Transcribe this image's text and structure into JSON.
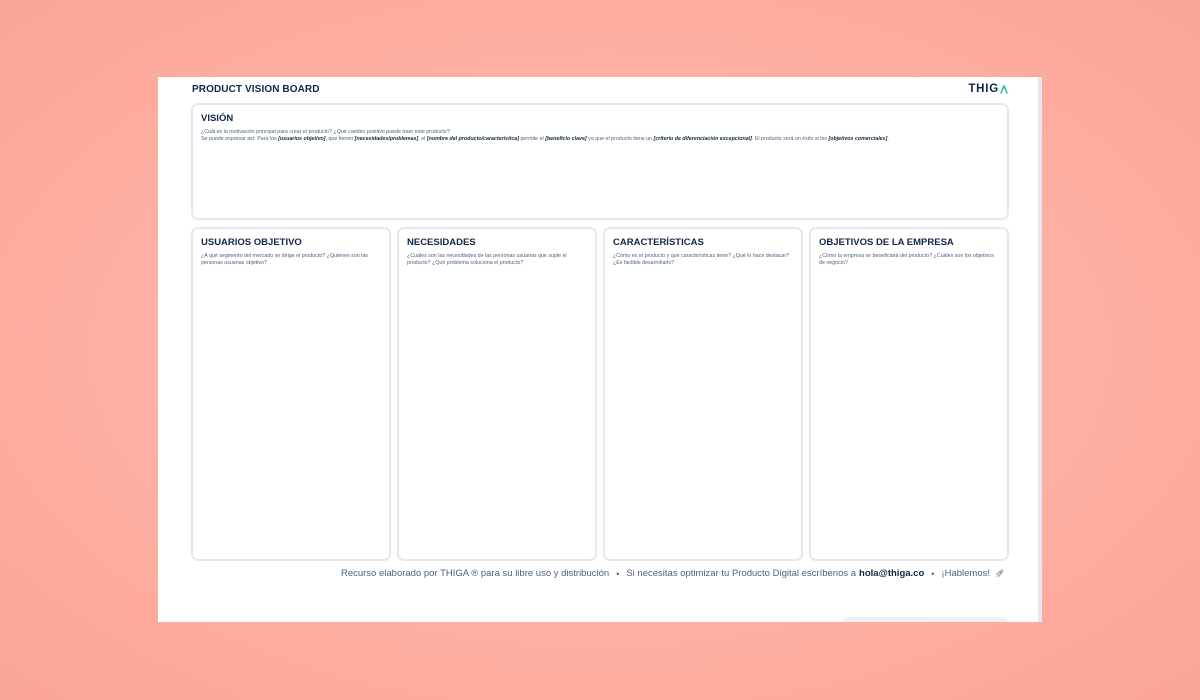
{
  "board": {
    "title": "PRODUCT VISION BOARD",
    "logo": "THIG",
    "vision": {
      "title": "VISIÓN",
      "line1": "¿Cuál es la motivación principal para crear el producto? ¿Qué cambio positivo puede traer este producto?",
      "p1": "Se puede expresar así: Para los ",
      "e1": "[usuarios objetivo]",
      "p2": ", que tienen ",
      "e2": "[necesidades/problemas]",
      "p3": ", el ",
      "e3": "[nombre del producto/característica]",
      "p4": " permite el ",
      "e4": "[beneficio clave]",
      "p5": " ya que el producto tiene un ",
      "e5": "[criterio de diferenciación excepcional]",
      "p6": ". El producto será un éxito si los ",
      "e6": "[objetivos comerciales]",
      "p7": "."
    },
    "columns": [
      {
        "title": "USUARIOS OBJETIVO",
        "desc": "¿A qué segmento del mercado se dirige el producto? ¿Quiénes son las personas usuarias objetivo?"
      },
      {
        "title": "NECESIDADES",
        "desc": "¿Cuáles son las necesidades de las personas usuarias que suple el producto? ¿Qué problema soluciona el producto?"
      },
      {
        "title": "CARACTERÍSTICAS",
        "desc": "¿Cómo es el producto y qué características tiene? ¿Qué lo hace destacar? ¿Es factible desarrollarlo?"
      },
      {
        "title": "OBJETIVOS DE LA EMPRESA",
        "desc": "¿Cómo la empresa se beneficiará del producto? ¿Cuáles son los objetivos de negocio?"
      }
    ],
    "footer": {
      "part1": "Recurso elaborado por THIGA ® para su libre uso y distribución",
      "separator": "•",
      "part2": "Si necesitas optimizar tu Producto Digital escríbenos a",
      "email": "hola@thiga.co",
      "part3": "¡Hablemos!"
    }
  },
  "colors": {
    "background": "#ffb3a5",
    "navy": "#0f2746",
    "accent_green": "#2ec4a0",
    "card_border": "#e8e8ec"
  },
  "icons": {
    "logo_mark": "chevron-a-icon",
    "footer": "rocket-icon"
  }
}
